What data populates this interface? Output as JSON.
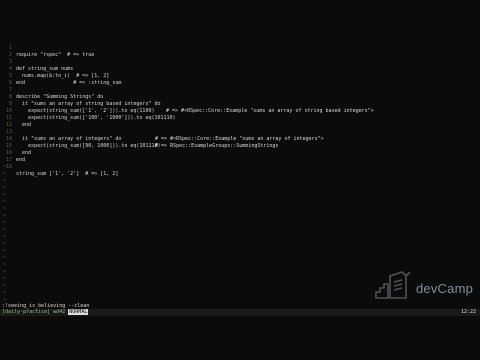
{
  "editor": {
    "lines": [
      {
        "n": "1",
        "text": "require \"rspec\"  # => true"
      },
      {
        "n": "2",
        "text": ""
      },
      {
        "n": "3",
        "text": "def string_sum nums"
      },
      {
        "n": "4",
        "text": "  nums.map(&:to_i)  # => [1, 2]"
      },
      {
        "n": "5",
        "text": "end                # => :string_sum"
      },
      {
        "n": "6",
        "text": ""
      },
      {
        "n": "7",
        "text": "describe \"Summing Strings\" do"
      },
      {
        "n": "8",
        "text": "  it \"sums an array of string based integers\" do"
      },
      {
        "n": "9",
        "text": "    expect(string_sum(['1', '2'])).to eq(1100)"
      },
      {
        "n": "10",
        "text": "    expect(string_sum(['100', '1000'])).to eq(101110)"
      },
      {
        "n": "11",
        "text": "  end"
      },
      {
        "n": "12",
        "text": ""
      },
      {
        "n": "13",
        "text": "  it \"sums an array of integers\" do"
      },
      {
        "n": "14",
        "text": "    expect(string_sum([90, 1000])).to eq(101110)"
      },
      {
        "n": "15",
        "text": "  end"
      },
      {
        "n": "16",
        "text": "end"
      },
      {
        "n": "17",
        "text": ""
      },
      {
        "n": "18",
        "text": "string_sum ['1', '2']  # => [1, 2]"
      }
    ],
    "results": {
      "r11": "# => #<RSpec::Core::Example \"sums an array of string based integers\">",
      "r15": "# => #<RSpec::Core::Example \"sums an array of integers\">",
      "r16": "# => RSpec::ExampleGroups::SummingStrings"
    },
    "tilde": "~"
  },
  "cmdline": ":!seeing_is_believing --clean",
  "status": {
    "left": "[daily-practice] wd42",
    "mode": "NORMAL",
    "right": "12:22"
  },
  "logo": {
    "text": "devCamp",
    "icon": "rocket-skyline-icon"
  },
  "colors": {
    "background": "#0b0b0b",
    "keyword": "#c96a62",
    "string": "#b8bb26",
    "number": "#d3869b",
    "tilde": "#3c6fb4"
  }
}
